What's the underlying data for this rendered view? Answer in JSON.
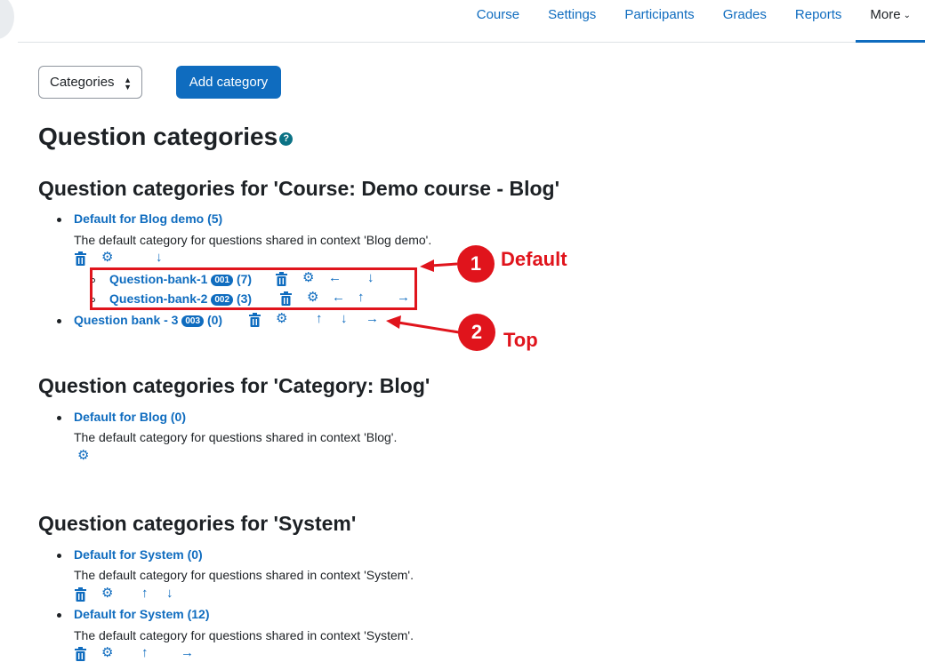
{
  "nav": {
    "items": [
      "Course",
      "Settings",
      "Participants",
      "Grades",
      "Reports"
    ],
    "more_label": "More"
  },
  "toolbar": {
    "select_value": "Categories",
    "add_button": "Add category"
  },
  "page": {
    "title": "Question categories",
    "help_glyph": "?"
  },
  "sections": [
    {
      "heading": "Question categories for 'Course: Demo course - Blog'",
      "default_name": "Default for Blog demo (5)",
      "default_desc": "The default category for questions shared in context 'Blog demo'.",
      "children": [
        {
          "name": "Question-bank-1",
          "badge": "001",
          "count": "(7)"
        },
        {
          "name": "Question-bank-2",
          "badge": "002",
          "count": "(3)"
        }
      ],
      "top_item": {
        "name": "Question bank - 3",
        "badge": "003",
        "count": "(0)"
      }
    },
    {
      "heading": "Question categories for 'Category: Blog'",
      "default_name": "Default for Blog (0)",
      "default_desc": "The default category for questions shared in context 'Blog'."
    },
    {
      "heading": "Question categories for 'System'",
      "items": [
        {
          "name": "Default for System (0)",
          "desc": "The default category for questions shared in context 'System'."
        },
        {
          "name": "Default for System (12)",
          "desc": "The default category for questions shared in context 'System'."
        }
      ]
    }
  ],
  "annotations": [
    {
      "number": "1",
      "label": "Default"
    },
    {
      "number": "2",
      "label": "Top"
    }
  ],
  "colors": {
    "link": "#0f6cbf",
    "annotation": "#e0141c"
  }
}
